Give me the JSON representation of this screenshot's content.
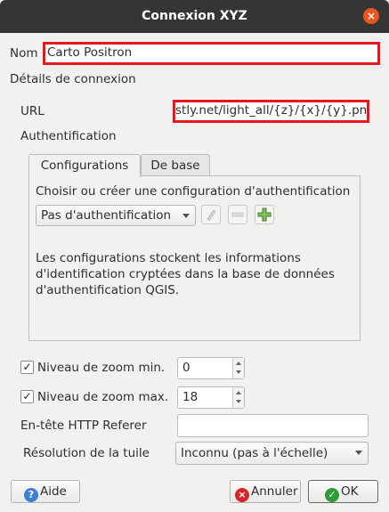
{
  "window": {
    "title": "Connexion XYZ",
    "close_glyph": "×"
  },
  "name_field": {
    "label": "Nom",
    "value": "Carto Positron"
  },
  "connection": {
    "section_label": "Détails de connexion",
    "url_label": "URL",
    "url_value": "stly.net/light_all/{z}/{x}/{y}.png"
  },
  "auth": {
    "section_label": "Authentification",
    "tabs": [
      {
        "label": "Configurations",
        "active": true
      },
      {
        "label": "De base",
        "active": false
      }
    ],
    "choose_label": "Choisir ou créer une configuration d'authentification",
    "config_select": "Pas d'authentification",
    "icons": [
      "edit-icon",
      "remove-icon",
      "add-icon"
    ],
    "info_text": "Les configurations stockent les informations d'identification cryptées dans la base de données d'authentification QGIS."
  },
  "zoom": {
    "min_label": "Niveau de zoom min.",
    "min_checked": true,
    "min_value": "0",
    "max_label": "Niveau de zoom max.",
    "max_checked": true,
    "max_value": "18"
  },
  "referer": {
    "label": "En-tête HTTP Referer",
    "value": ""
  },
  "tile_resolution": {
    "label": "Résolution de la tuile",
    "selected": "Inconnu (pas à l'échelle)"
  },
  "buttons": {
    "help": "Aide",
    "cancel": "Annuler",
    "ok": "OK"
  },
  "colors": {
    "titlebar": "#353534",
    "close_accent": "#e95420",
    "highlight_border": "#e8161d",
    "help_icon": "#3c7fd1",
    "cancel_icon": "#d6262c",
    "ok_icon": "#2e9a3a"
  }
}
